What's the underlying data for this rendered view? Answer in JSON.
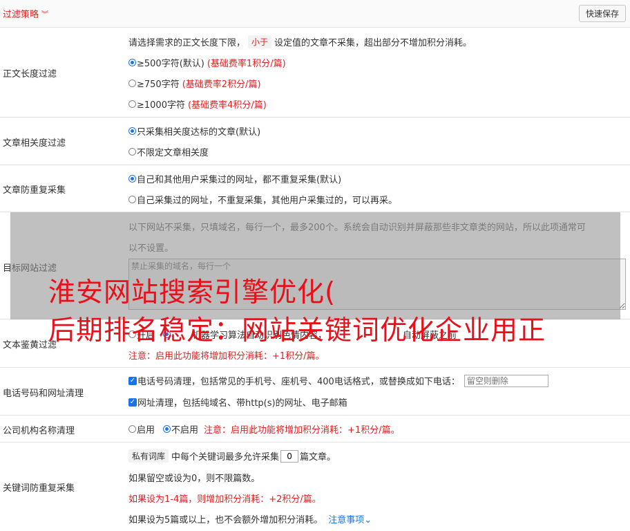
{
  "header": {
    "title": "过滤策略",
    "save_label": "快速保存"
  },
  "length_filter": {
    "label": "正文长度过滤",
    "desc_pre": "请选择需求的正文长度下限，",
    "desc_tag": "小于",
    "desc_post": "设定值的文章不采集，超出部分不增加积分消耗。",
    "options": [
      {
        "text": "≥500字符(默认)",
        "note": "(基础费率1积分/篇)",
        "selected": true
      },
      {
        "text": "≥750字符",
        "note": "(基础费率2积分/篇)",
        "selected": false
      },
      {
        "text": "≥1000字符",
        "note": "(基础费率4积分/篇)",
        "selected": false
      }
    ]
  },
  "relevance_filter": {
    "label": "文章相关度过滤",
    "options": [
      {
        "text": "只采集相关度达标的文章(默认)",
        "selected": true
      },
      {
        "text": "不限定文章相关度",
        "selected": false
      }
    ]
  },
  "duplicate_filter": {
    "label": "文章防重复采集",
    "options": [
      {
        "text": "自己和其他用户采集过的网址，都不重复采集(默认)",
        "selected": true
      },
      {
        "text": "自己采集过的网址，不重复采集，其他用户采集过的，可以再采。",
        "selected": false
      }
    ]
  },
  "site_filter": {
    "label": "目标网站过滤",
    "desc_line1": "以下网站不采集，只填域名，每行一个，最多200个。系统会自动识别并屏蔽那些非文章类的网站，所以此项通常可",
    "desc_line2": "以不设置。",
    "placeholder": "禁止采集的域名，每行一个"
  },
  "content_check": {
    "label": "文本鉴黄过滤",
    "opt_on": "开启",
    "opt_mid": "机器学习算法自动识别色情内容，",
    "opt_tail": "自动屏蔽之前",
    "notice": "注意：启用此功能将增加积分消耗：+1积分/篇。"
  },
  "phone_url_clean": {
    "label": "电话号码和网址清理",
    "phone_text": "电话号码清理，包括常见的手机号、座机号、400电话格式，或替换成如下电话：",
    "phone_placeholder": "留空则删除",
    "url_text": "网址清理，包括纯域名、带http(s)的网址、电子邮箱"
  },
  "company_clean": {
    "label": "公司机构名称清理",
    "opt_on": "启用",
    "opt_off": "不启用",
    "notice": "注意：启用此功能将增加积分消耗：+1积分/篇。"
  },
  "keyword_dup": {
    "label": "关键词防重复采集",
    "tag": "私有词库",
    "line1_pre": "中每个关键词最多允许采集",
    "count": "0",
    "line1_post": "篇文章。",
    "line2": "如果留空或设为0，则不限篇数。",
    "line3": "如果设为1-4篇，则增加积分消耗：+2积分/篇。",
    "line4": "如果设为5篇或以上，也不会额外增加积分消耗。",
    "link": "注意事项"
  },
  "watermark": {
    "line1": "淮安网站搜索引擎优化(",
    "line2": "后期排名稳定：网站关键词优化企业用正"
  }
}
